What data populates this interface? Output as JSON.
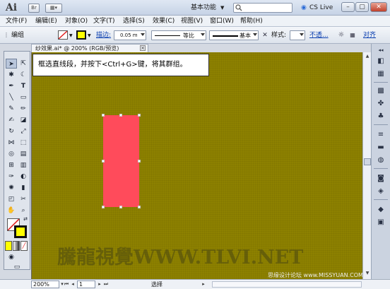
{
  "titlebar": {
    "logo": "Ai",
    "br_icon": "Br",
    "workspace": "基本功能",
    "cs_live": "CS Live",
    "minimize": "–",
    "restore": "▢",
    "close": "✕"
  },
  "menu": [
    "文件(F)",
    "编辑(E)",
    "对象(O)",
    "文字(T)",
    "选择(S)",
    "效果(C)",
    "视图(V)",
    "窗口(W)",
    "帮助(H)"
  ],
  "control": {
    "group_label": "编组",
    "stroke_label": "描边:",
    "stroke_value": "0.05 m",
    "profile_label": "等比",
    "brush_label": "基本",
    "style_label": "样式:",
    "opacity_label": "不透...",
    "align_label": "对齐"
  },
  "document": {
    "tab_title": "纱效果.ai* @ 200% (RGB/预览)",
    "instruction": "框选直线段，并按下<Ctrl+G>键，将其群组。",
    "watermark": "騰龍視覺WWW.TLVI.NET",
    "credit": "思缘设计论坛 www.MISSYUAN.COM"
  },
  "colors": {
    "canvas": "#8d8100",
    "shape_fill": "#ff4b5b",
    "fill_swatch": "#ffff00"
  },
  "status": {
    "zoom": "200%",
    "page": "1",
    "tool": "选择"
  }
}
